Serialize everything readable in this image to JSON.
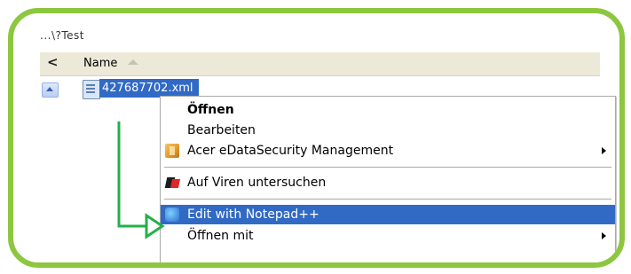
{
  "window": {
    "path_fragment": "...\\?Test"
  },
  "columns": {
    "nav_arrow": "<",
    "name_header": "Name"
  },
  "file": {
    "name": "427687702.xml"
  },
  "context_menu": {
    "items": [
      {
        "label": "Öffnen",
        "bold": true
      },
      {
        "label": "Bearbeiten"
      },
      {
        "label": "Acer eDataSecurity Management",
        "icon": "acer-edatasecurity-icon",
        "submenu": true
      },
      {
        "label": "Auf Viren untersuchen",
        "icon": "kaspersky-icon"
      },
      {
        "label": "Edit with Notepad++",
        "icon": "notepad-plus-plus-icon",
        "highlighted": true
      },
      {
        "label": "Öffnen mit",
        "submenu": true
      }
    ]
  },
  "colors": {
    "frame_border": "#8dc63f",
    "selection": "#316ac5",
    "annotation_arrow": "#22b04a"
  }
}
